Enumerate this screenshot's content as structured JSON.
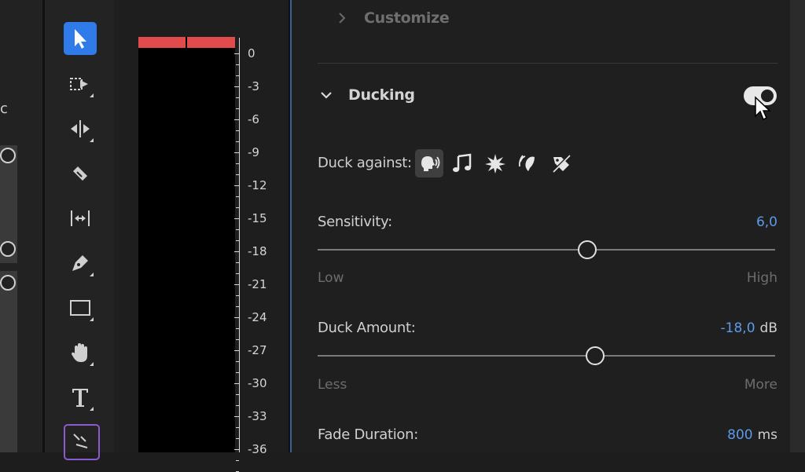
{
  "left_strip": {
    "cut_text": "c"
  },
  "tools": [
    {
      "name": "selection-tool",
      "icon": "arrow-pointer-icon",
      "active": true
    },
    {
      "name": "track-select-tool",
      "icon": "track-select-icon"
    },
    {
      "name": "ripple-edit-tool",
      "icon": "ripple-edit-icon"
    },
    {
      "name": "razor-tool",
      "icon": "razor-icon"
    },
    {
      "name": "slip-tool",
      "icon": "slip-icon"
    },
    {
      "name": "pen-tool",
      "icon": "pen-icon"
    },
    {
      "name": "rectangle-tool",
      "icon": "rectangle-icon"
    },
    {
      "name": "hand-tool",
      "icon": "hand-icon"
    },
    {
      "name": "type-tool",
      "icon": "type-icon"
    },
    {
      "name": "remix-tool",
      "icon": "remix-icon"
    }
  ],
  "meter": {
    "scale": [
      "0",
      "-3",
      "-6",
      "-9",
      "-12",
      "-15",
      "-18",
      "-21",
      "-24",
      "-27",
      "-30",
      "-33",
      "-36"
    ]
  },
  "panel": {
    "customize": {
      "title": "Customize",
      "expanded": false
    },
    "ducking": {
      "title": "Ducking",
      "enabled": true,
      "duck_against_label": "Duck against:",
      "duck_against_icons": [
        "dialogue-icon",
        "music-icon",
        "sfx-icon",
        "ambience-icon",
        "untagged-icon"
      ],
      "selected_icon": "dialogue-icon",
      "sensitivity": {
        "label": "Sensitivity:",
        "value": "6,0",
        "fraction": 0.59,
        "low": "Low",
        "high": "High"
      },
      "duck_amount": {
        "label": "Duck Amount:",
        "value": "-18,0",
        "unit": "dB",
        "fraction": 0.606,
        "low": "Less",
        "high": "More"
      },
      "fade_duration": {
        "label": "Fade Duration:",
        "value": "800",
        "unit": "ms"
      }
    }
  },
  "colors": {
    "accent": "#2f7bea",
    "value_blue": "#5b9be8",
    "peak_red": "#e14b4b"
  }
}
